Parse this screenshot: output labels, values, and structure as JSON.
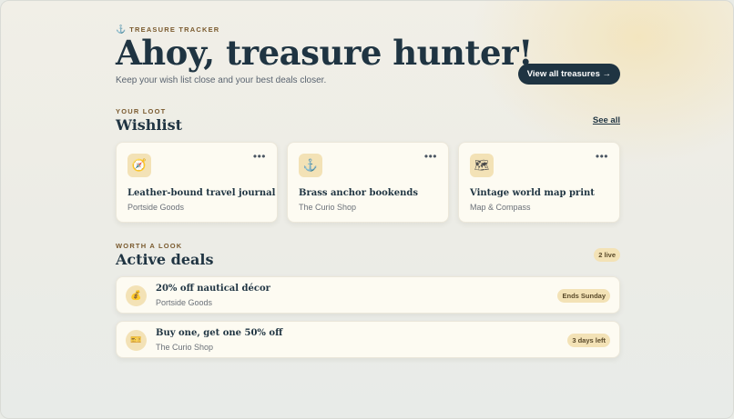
{
  "header": {
    "brand_icon": "anchor-icon",
    "brand_label": "TREASURE TRACKER",
    "title": "Ahoy, treasure hunter!",
    "subtitle": "Keep your wish list close and your best deals closer.",
    "cta_label": "View all treasures →"
  },
  "wishlist": {
    "eyebrow": "YOUR LOOT",
    "title": "Wishlist",
    "see_all": "See all",
    "items": [
      {
        "icon": "compass-icon",
        "glyph": "🧭",
        "title": "Leather-bound travel journal",
        "shop": "Portside Goods",
        "more": "•••"
      },
      {
        "icon": "anchor-icon",
        "glyph": "⚓",
        "title": "Brass anchor bookends",
        "shop": "The Curio Shop",
        "more": "•••"
      },
      {
        "icon": "map-icon",
        "glyph": "🗺",
        "title": "Vintage world map print",
        "shop": "Map & Compass",
        "more": "•••"
      }
    ]
  },
  "deals": {
    "eyebrow": "WORTH A LOOK",
    "title": "Active deals",
    "live_badge": "2 live",
    "items": [
      {
        "icon": "money-bag-icon",
        "glyph": "💰",
        "title": "20% off nautical décor",
        "shop": "Portside Goods",
        "badge": "Ends Sunday"
      },
      {
        "icon": "ticket-icon",
        "glyph": "🎫",
        "title": "Buy one, get one 50% off",
        "shop": "The Curio Shop",
        "badge": "3 days left"
      }
    ]
  },
  "colors": {
    "primary": "#1f3442",
    "accent": "#f3e2b6",
    "eyebrow": "#7a5a2e",
    "card": "#fdfbf2"
  }
}
